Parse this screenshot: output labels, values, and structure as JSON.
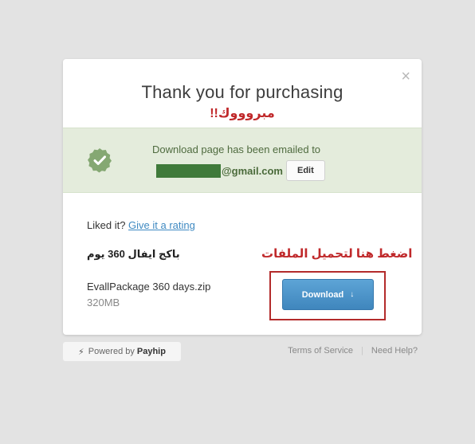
{
  "modal": {
    "close_glyph": "×",
    "title": "Thank you for purchasing",
    "arabic_congrats": "مبروووك!!",
    "notice": {
      "text": "Download page has been emailed to",
      "email_domain": "@gmail.com",
      "edit_label": "Edit"
    },
    "rating": {
      "prefix": "Liked it?",
      "link": "Give it a rating"
    },
    "package_name": "باكج ايفال 360 يوم",
    "arabic_hint": "اضغط هنا لتحميل الملفات",
    "file": {
      "name": "EvallPackage 360 days.zip",
      "size": "320MB"
    },
    "download": {
      "label": "Download",
      "arrow": "↓"
    }
  },
  "footer": {
    "powered_prefix": "Powered by",
    "brand": "Payhip",
    "terms": "Terms of Service",
    "help": "Need Help?"
  },
  "colors": {
    "background": "#e3e3e3",
    "notice_bg": "#e4ecdc",
    "check_badge": "#85a873",
    "accent_red": "#c0292b",
    "download_blue": "#4a93c8",
    "link_blue": "#3f8ac2"
  }
}
